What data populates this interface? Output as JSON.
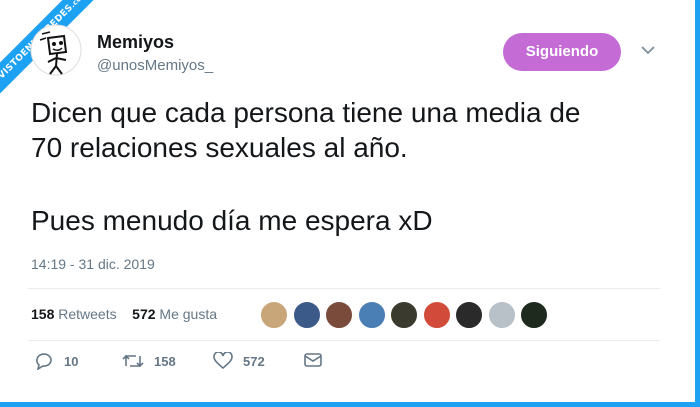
{
  "watermark": {
    "line1": "VISTOENLASREDES",
    "line2": ".com"
  },
  "user": {
    "name": "Memiyos",
    "handle": "@unosMemiyos_"
  },
  "follow_button": {
    "label": "Siguiendo",
    "color": "#c46bd6"
  },
  "tweet": {
    "line1": "Dicen que cada persona tiene una media de",
    "line2": "70 relaciones sexuales al año.",
    "line3": "Pues menudo día me espera xD"
  },
  "timestamp": "14:19 - 31 dic. 2019",
  "stats": {
    "retweets_count": "158",
    "retweets_label": "Retweets",
    "likes_count": "572",
    "likes_label": "Me gusta"
  },
  "likers": [
    {
      "color": "#c9a57a"
    },
    {
      "color": "#3b5a8a"
    },
    {
      "color": "#7a4a3a"
    },
    {
      "color": "#4a7fb5"
    },
    {
      "color": "#3a3a2e"
    },
    {
      "color": "#d14a3a"
    },
    {
      "color": "#2a2a2a"
    },
    {
      "color": "#b8c0c8"
    },
    {
      "color": "#1e2a1e"
    }
  ],
  "actions": {
    "reply_count": "10",
    "retweet_count": "158",
    "like_count": "572"
  },
  "colors": {
    "accent": "#1da1f2",
    "text": "#14171a",
    "muted": "#657786"
  }
}
